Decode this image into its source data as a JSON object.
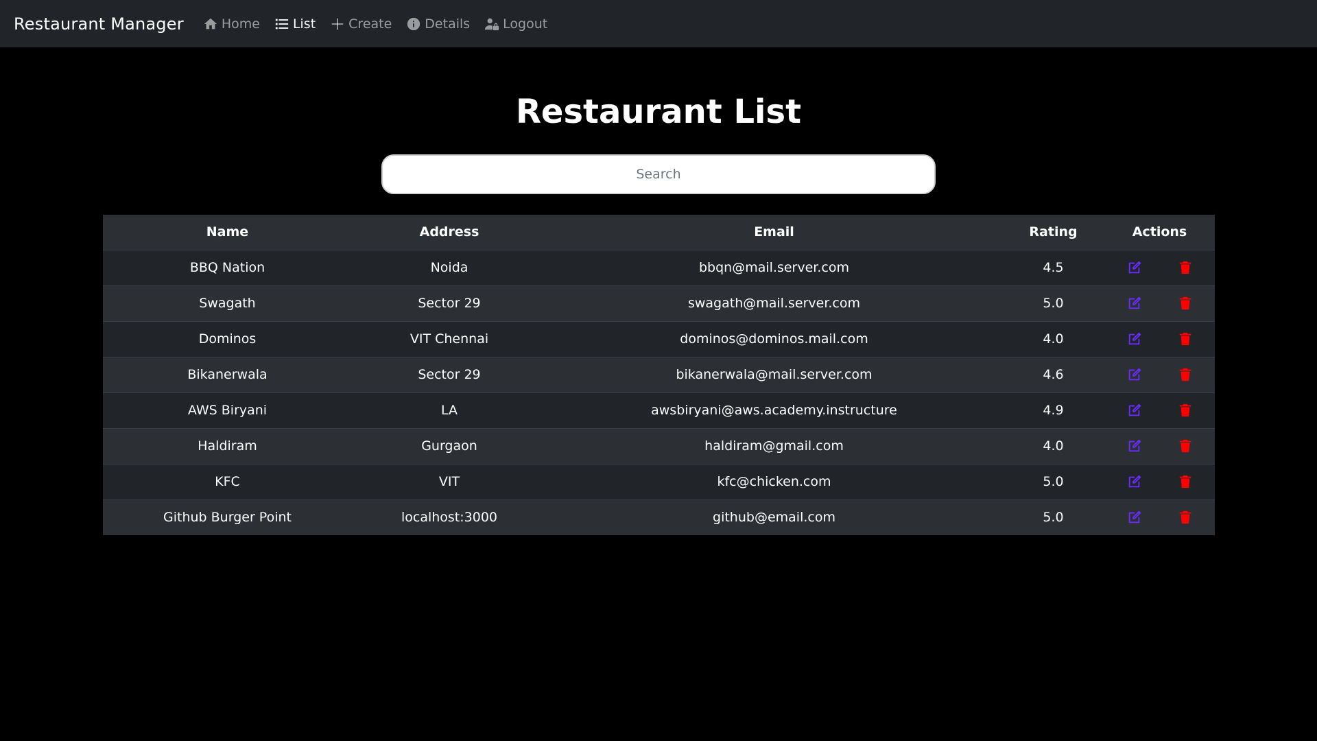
{
  "navbar": {
    "brand": "Restaurant Manager",
    "items": [
      {
        "label": "Home",
        "icon": "home-icon"
      },
      {
        "label": "List",
        "icon": "list-icon"
      },
      {
        "label": "Create",
        "icon": "plus-icon"
      },
      {
        "label": "Details",
        "icon": "info-icon"
      },
      {
        "label": "Logout",
        "icon": "user-lock-icon"
      }
    ],
    "active": "List"
  },
  "main": {
    "title": "Restaurant List",
    "search": {
      "placeholder": "Search",
      "value": ""
    }
  },
  "table": {
    "headers": [
      "Name",
      "Address",
      "Email",
      "Rating",
      "Actions"
    ],
    "rows": [
      {
        "name": "BBQ Nation",
        "address": "Noida",
        "email": "bbqn@mail.server.com",
        "rating": "4.5"
      },
      {
        "name": "Swagath",
        "address": "Sector 29",
        "email": "swagath@mail.server.com",
        "rating": "5.0"
      },
      {
        "name": "Dominos",
        "address": "VIT Chennai",
        "email": "dominos@dominos.mail.com",
        "rating": "4.0"
      },
      {
        "name": "Bikanerwala",
        "address": "Sector 29",
        "email": "bikanerwala@mail.server.com",
        "rating": "4.6"
      },
      {
        "name": "AWS Biryani",
        "address": "LA",
        "email": "awsbiryani@aws.academy.instructure",
        "rating": "4.9"
      },
      {
        "name": "Haldiram",
        "address": "Gurgaon",
        "email": "haldiram@gmail.com",
        "rating": "4.0"
      },
      {
        "name": "KFC",
        "address": "VIT",
        "email": "kfc@chicken.com",
        "rating": "5.0"
      },
      {
        "name": "Github Burger Point",
        "address": "localhost:3000",
        "email": "github@email.com",
        "rating": "5.0"
      }
    ]
  },
  "colors": {
    "navbar_bg": "#212529",
    "page_bg": "#000000",
    "edit_icon": "#6a2bff",
    "delete_icon": "#ff0000"
  }
}
